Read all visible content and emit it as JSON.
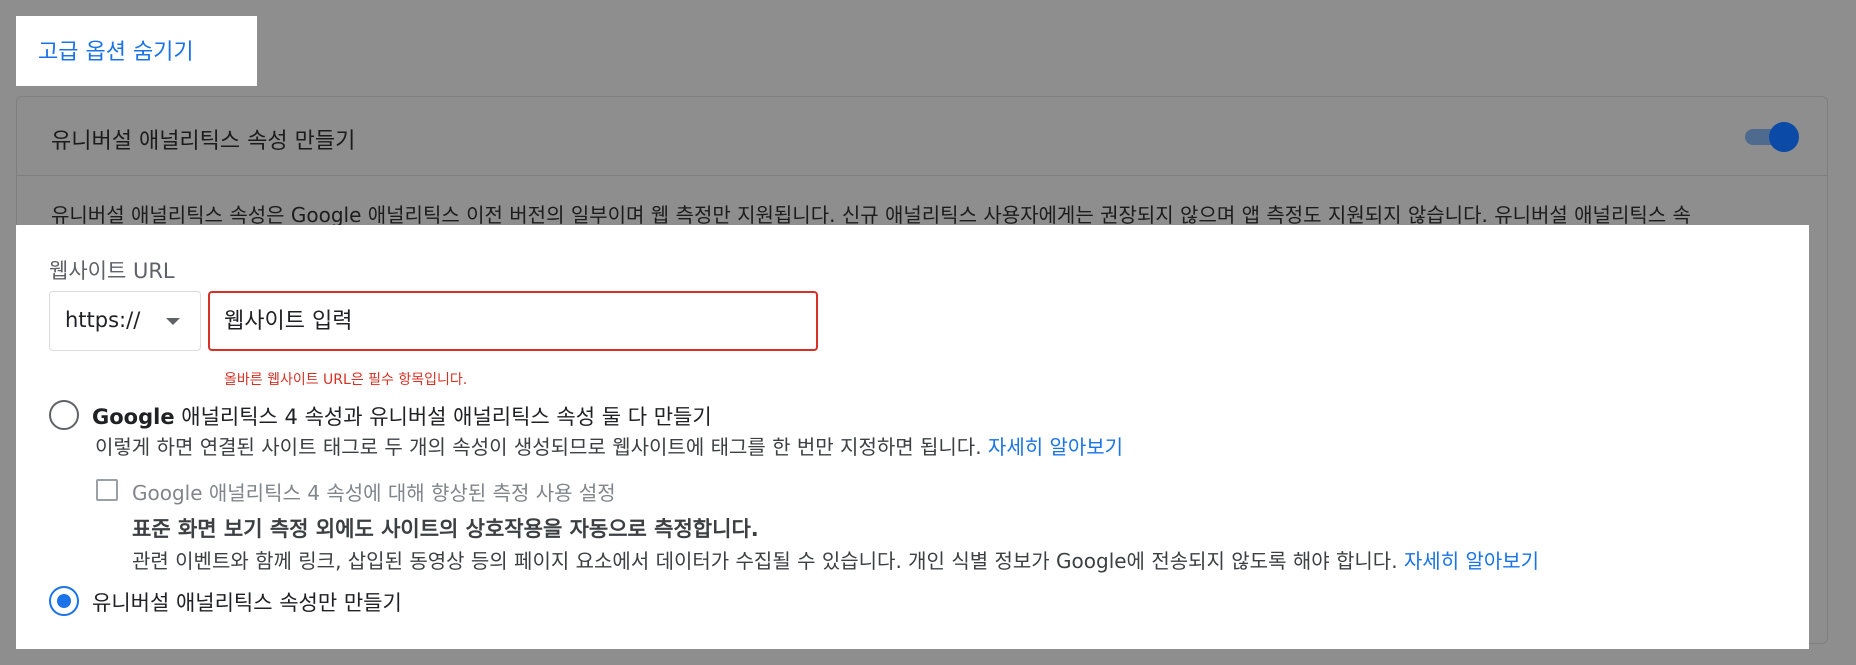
{
  "header": {
    "hide_advanced_label": "고급 옵션 숨기기"
  },
  "universal_section": {
    "title": "유니버설 애널리틱스 속성 만들기",
    "toggle_on": true,
    "description": "유니버설 애널리틱스 속성은 Google 애널리틱스 이전 버전의 일부이며 웹 측정만 지원됩니다. 신규 애널리틱스 사용자에게는 권장되지 않으며 앱 측정도 지원되지 않습니다. 유니버설 애널리틱스 속"
  },
  "website_url": {
    "label": "웹사이트 URL",
    "protocol_selected": "https://",
    "input_placeholder": "웹사이트 입력",
    "error_text": "올바른 웹사이트 URL은 필수 항목입니다."
  },
  "options": {
    "both": {
      "label_prefix": "Google",
      "label_rest": " 애널리틱스 4 속성과 유니버설 애널리틱스 속성 둘 다 만들기",
      "description": "이렇게 하면 연결된 사이트 태그로 두 개의 속성이 생성되므로 웹사이트에 태그를 한 번만 지정하면 됩니다.",
      "learn_more": "자세히 알아보기",
      "selected": false
    },
    "enhanced": {
      "checkbox_label": "Google 애널리틱스 4 속성에 대해 향상된 측정 사용 설정",
      "title": "표준 화면 보기 측정 외에도 사이트의 상호작용을 자동으로 측정합니다.",
      "description": "관련 이벤트와 함께 링크, 삽입된 동영상 등의 페이지 요소에서 데이터가 수집될 수 있습니다. 개인 식별 정보가 Google에 전송되지 않도록 해야 합니다.",
      "learn_more": "자세히 알아보기",
      "checked": false
    },
    "universal_only": {
      "label": "유니버설 애널리틱스 속성만 만들기",
      "selected": true
    }
  },
  "colors": {
    "accent": "#1a73e8",
    "error": "#d93025",
    "scrim": "#8e8e8e"
  }
}
